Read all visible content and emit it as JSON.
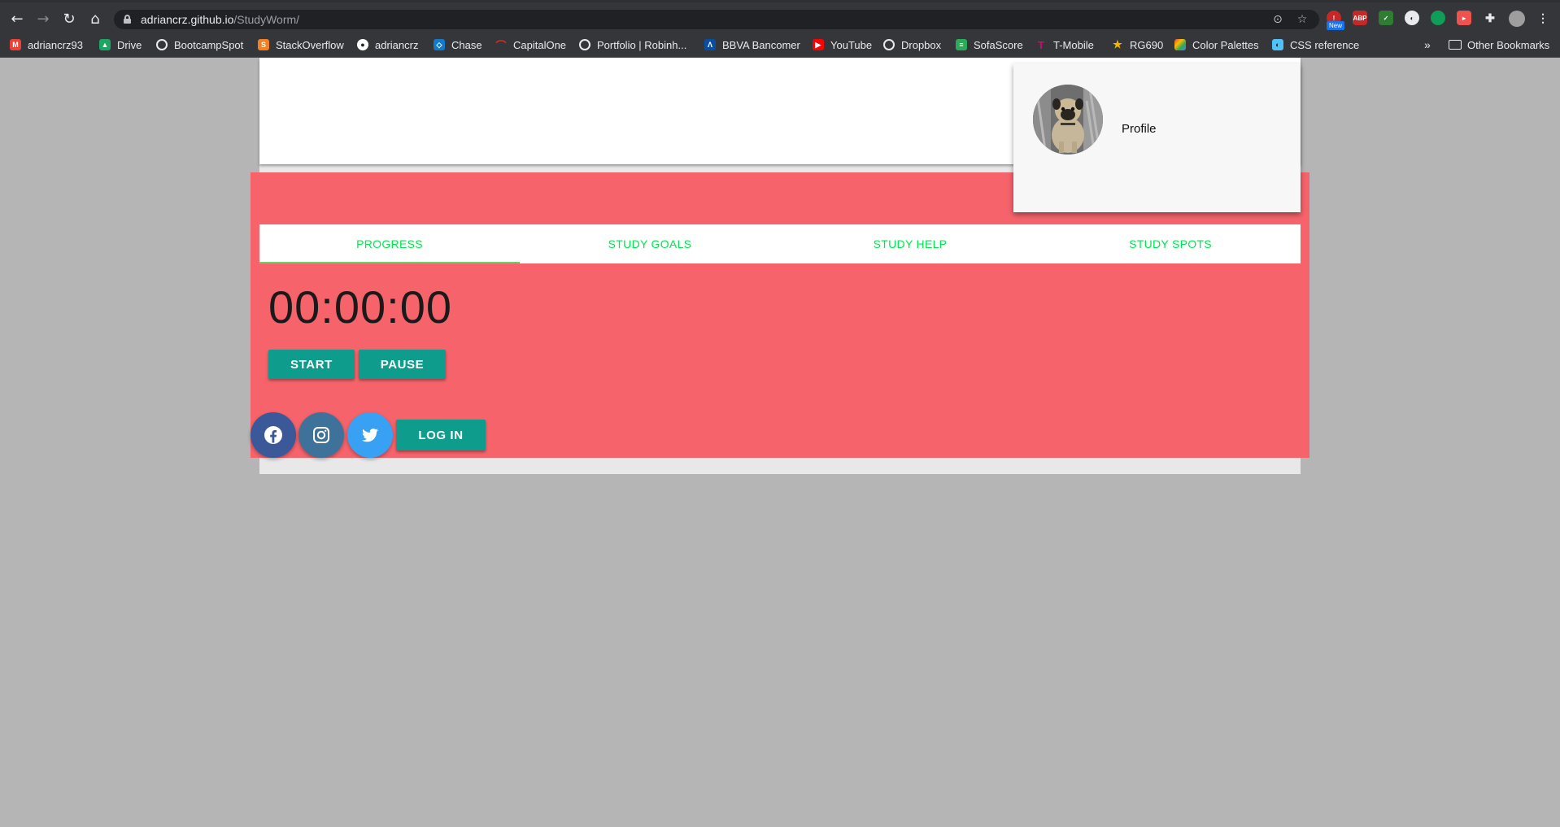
{
  "browser": {
    "url_domain": "adriancrz.github.io",
    "url_path": "/StudyWorm/",
    "new_badge": "New",
    "bookmarks": [
      {
        "label": "adriancrz93",
        "icon": "gmail-icon",
        "color": "#ea4335"
      },
      {
        "label": "Drive",
        "icon": "drive-icon",
        "color": "#1fa463"
      },
      {
        "label": "BootcampSpot",
        "icon": "globe-icon",
        "color": ""
      },
      {
        "label": "StackOverflow",
        "icon": "stackoverflow-icon",
        "color": "#f48024"
      },
      {
        "label": "adriancrz",
        "icon": "github-icon",
        "color": "#ffffff"
      },
      {
        "label": "Chase",
        "icon": "chase-icon",
        "color": "#117aca"
      },
      {
        "label": "CapitalOne",
        "icon": "capitalone-icon",
        "color": "#d03027"
      },
      {
        "label": "Portfolio | Robinh...",
        "icon": "globe-icon",
        "color": ""
      },
      {
        "label": "BBVA Bancomer",
        "icon": "bbva-icon",
        "color": "#0a4ea3"
      },
      {
        "label": "YouTube",
        "icon": "youtube-icon",
        "color": "#ff0000"
      },
      {
        "label": "Dropbox",
        "icon": "globe-icon",
        "color": ""
      },
      {
        "label": "SofaScore",
        "icon": "sofascore-icon",
        "color": "#2bab5a"
      },
      {
        "label": "T-Mobile",
        "icon": "tmobile-icon",
        "color": "#e20074"
      },
      {
        "label": "RG690",
        "icon": "star-icon",
        "color": "#f4b400"
      },
      {
        "label": "Color Palettes",
        "icon": "palette-icon",
        "color": "#fbbc04"
      },
      {
        "label": "CSS reference",
        "icon": "css-icon",
        "color": "#4fc3f7"
      }
    ],
    "more_bookmarks": "»",
    "other_bookmarks": "Other Bookmarks"
  },
  "profile_menu": {
    "label": "Profile"
  },
  "tabs": [
    {
      "label": "PROGRESS",
      "active": true
    },
    {
      "label": "STUDY GOALS",
      "active": false
    },
    {
      "label": "STUDY HELP",
      "active": false
    },
    {
      "label": "STUDY SPOTS",
      "active": false
    }
  ],
  "timer": {
    "display": "00:00:00",
    "start_label": "START",
    "pause_label": "PAUSE"
  },
  "footer": {
    "social": [
      {
        "name": "facebook",
        "color": "#3b5998"
      },
      {
        "name": "instagram",
        "color": "#3f729b"
      },
      {
        "name": "twitter",
        "color": "#38a1f3"
      }
    ],
    "login_label": "LOG IN"
  },
  "colors": {
    "panel": "#f6636b",
    "accent_button": "#0e9d8c",
    "tab_text": "#00e64d",
    "page_bg": "#b5b5b5"
  }
}
